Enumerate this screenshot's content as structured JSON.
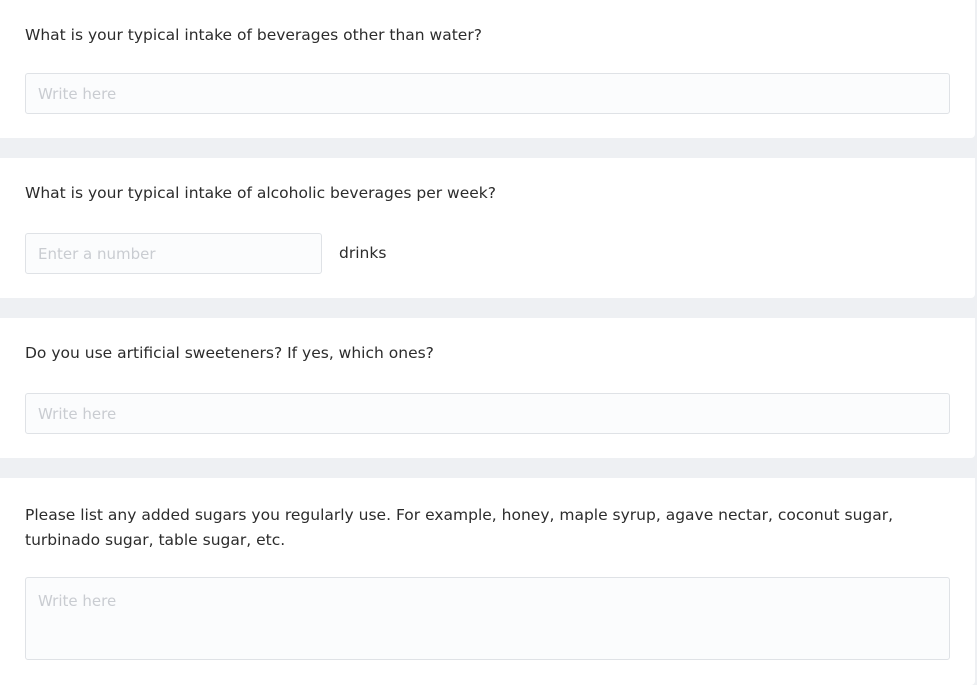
{
  "questions": [
    {
      "text": "What is your typical intake of beverages other than water?",
      "placeholder": "Write here"
    },
    {
      "text": "What is your typical intake of alcoholic beverages per week?",
      "placeholder": "Enter a number",
      "unit": "drinks"
    },
    {
      "text": "Do you use artificial sweeteners? If yes, which ones?",
      "placeholder": "Write here"
    },
    {
      "text": "Please list any added sugars you regularly use. For example, honey, maple syrup, agave nectar, coconut sugar, turbinado sugar, table sugar, etc.",
      "placeholder": "Write here"
    }
  ],
  "colors": {
    "page_background": "#eef0f3",
    "card_background": "#ffffff",
    "field_border": "#dfe2e6",
    "placeholder": "#c9ccd1",
    "text": "#2c2c2c"
  }
}
